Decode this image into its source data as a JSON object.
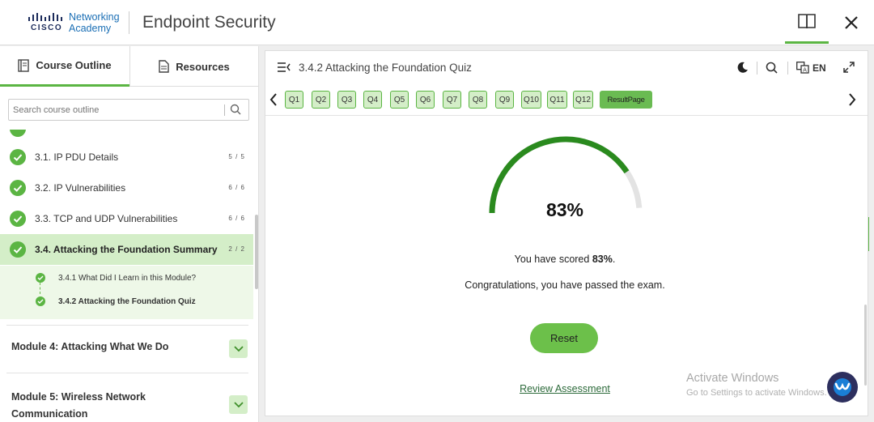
{
  "header": {
    "logo_lines": [
      "Networking",
      "Academy"
    ],
    "logo_brand": "CISCO",
    "title": "Endpoint Security"
  },
  "sidebar": {
    "tabs": [
      {
        "label": "Course Outline",
        "icon": "course-outline-icon",
        "active": true
      },
      {
        "label": "Resources",
        "icon": "resources-icon",
        "active": false
      }
    ],
    "search_placeholder": "Search course outline",
    "sections": [
      {
        "label": "3.1. IP PDU Details",
        "count": "5 / 5",
        "completed": true
      },
      {
        "label": "3.2. IP Vulnerabilities",
        "count": "6 / 6",
        "completed": true
      },
      {
        "label": "3.3. TCP and UDP Vulnerabilities",
        "count": "6 / 6",
        "completed": true
      },
      {
        "label": "3.4. Attacking the Foundation Summary",
        "count": "2 / 2",
        "completed": true,
        "active": true
      }
    ],
    "subitems": [
      {
        "label": "3.4.1 What Did I Learn in this Module?",
        "current": false
      },
      {
        "label": "3.4.2 Attacking the Foundation Quiz",
        "current": true
      }
    ],
    "modules": [
      {
        "label": "Module 4: Attacking What We Do"
      },
      {
        "label_lines": [
          "Module 5: Wireless Network",
          "Communication"
        ]
      }
    ]
  },
  "main": {
    "title": "3.4.2 Attacking the Foundation Quiz",
    "language": "EN",
    "questions": [
      "Q1",
      "Q2",
      "Q3",
      "Q4",
      "Q5",
      "Q6",
      "Q7",
      "Q8",
      "Q9",
      "Q10",
      "Q11",
      "Q12"
    ],
    "result_label": "ResultPage",
    "score_value": 0.83,
    "score_text": "83%",
    "score_prefix": "You have scored ",
    "score_bold": "83%",
    "score_suffix": ".",
    "congrats": "Congratulations, you have passed the exam.",
    "reset_label": "Reset",
    "review_label": "Review Assessment"
  },
  "watermark": {
    "line1": "Activate Windows",
    "line2": "Go to Settings to activate Windows."
  },
  "colors": {
    "accent": "#5bb543",
    "accent_light": "#d4eec8",
    "gauge_fill": "#2a8a1e",
    "gauge_track": "#e3e3e3"
  }
}
